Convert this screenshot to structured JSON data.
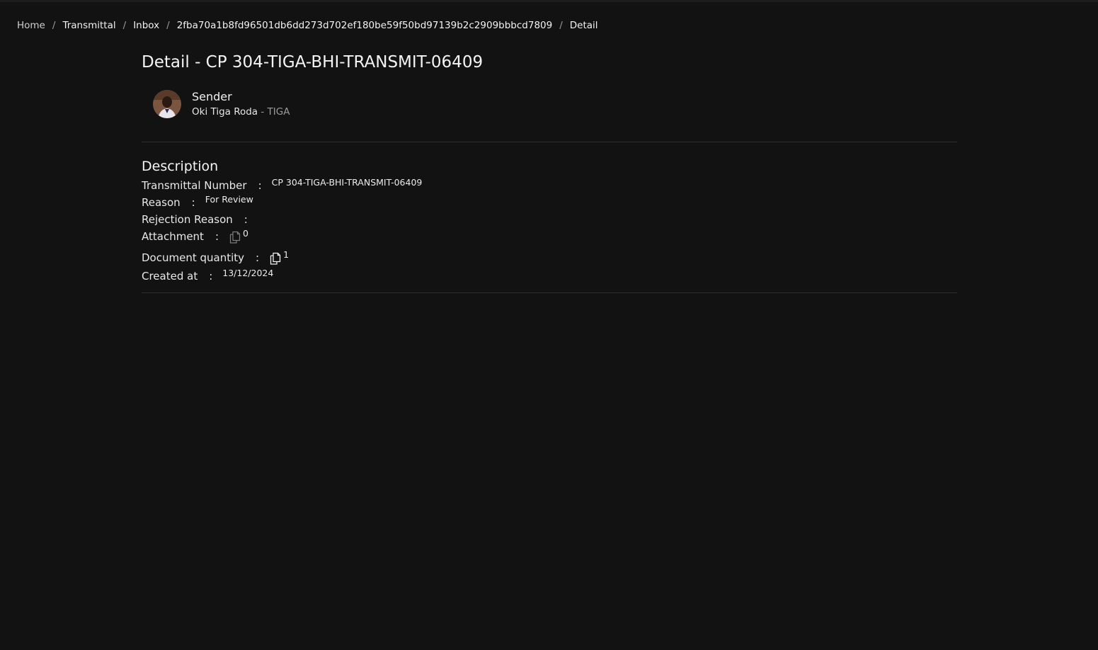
{
  "breadcrumb": {
    "items": [
      "Home",
      "Transmittal",
      "Inbox",
      "2fba70a1b8fd96501db6dd273d702ef180be59f50bd97139b2c2909bbbcd7809",
      "Detail"
    ],
    "separator": "/"
  },
  "page": {
    "title": "Detail - CP 304-TIGA-BHI-TRANSMIT-06409"
  },
  "sender": {
    "label": "Sender",
    "name": "Oki Tiga Roda",
    "org_separator": " - ",
    "org": "TIGA"
  },
  "description": {
    "title": "Description",
    "colon": ":",
    "transmittal_number_label": "Transmittal Number",
    "transmittal_number": "CP 304-TIGA-BHI-TRANSMIT-06409",
    "reason_label": "Reason",
    "reason": "For Review",
    "rejection_reason_label": "Rejection Reason",
    "rejection_reason": "",
    "attachment_label": "Attachment",
    "attachment_count": "0",
    "document_quantity_label": "Document quantity",
    "document_quantity": "1",
    "created_at_label": "Created at",
    "created_at": "13/12/2024"
  },
  "icons": {
    "attachment": "documents-icon",
    "document_quantity": "documents-icon"
  },
  "colors": {
    "background": "#121212",
    "divider": "#2e2e2e",
    "muted": "#9c9c9c"
  }
}
